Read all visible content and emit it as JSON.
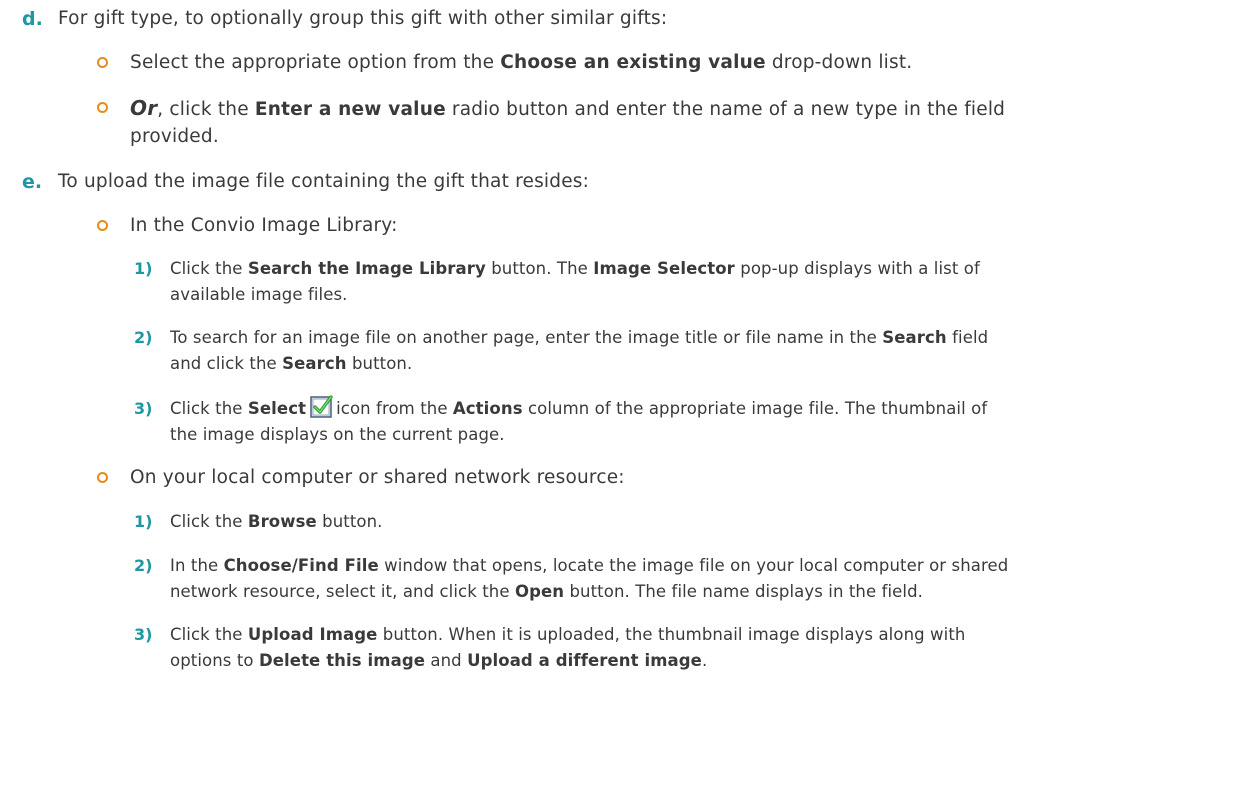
{
  "step_d": {
    "marker": "d.",
    "text": "For gift type, to optionally group this gift with other similar gifts:",
    "bullets": [
      {
        "pre": "Select the appropriate option from the ",
        "bold": "Choose an existing value",
        "post": " drop-down list."
      },
      {
        "or": "Or",
        "pre": ", click the ",
        "bold": "Enter a new value",
        "post_line1": " radio button and enter the name of a new type in the field",
        "post_line2": "provided."
      }
    ]
  },
  "step_e": {
    "marker": "e.",
    "text": "To upload the image file containing the gift that resides:",
    "library": {
      "heading": "In the Convio Image Library:",
      "steps": [
        {
          "num": "1)",
          "l1_pre": "Click the ",
          "l1_b1": "Search the Image Library",
          "l1_mid": " button. The ",
          "l1_b2": "Image Selector",
          "l1_post": " pop-up displays with a list of",
          "l2": "available image files."
        },
        {
          "num": "2)",
          "l1_pre": "To search for an image file on another page, enter the image title or file name in the ",
          "l1_b1": "Search",
          "l1_post": " field",
          "l2_pre": "and click the ",
          "l2_b1": "Search",
          "l2_post": " button."
        },
        {
          "num": "3)",
          "l1_pre": "Click the ",
          "l1_b1": "Select",
          "icon": "select-checkbox-icon",
          "l1_mid": "icon from the ",
          "l1_b2": "Actions",
          "l1_post": " column of the appropriate image file. The thumbnail of",
          "l2": "the image displays on the current page."
        }
      ]
    },
    "local": {
      "heading": "On your local computer or shared network resource:",
      "steps": [
        {
          "num": "1)",
          "l1_pre": "Click the ",
          "l1_b1": "Browse",
          "l1_post": " button."
        },
        {
          "num": "2)",
          "l1_pre": "In the ",
          "l1_b1": "Choose/Find File",
          "l1_post": " window that opens, locate the image file on your local computer or shared",
          "l2_pre": "network resource, select it, and click the ",
          "l2_b1": "Open",
          "l2_post": " button. The file name displays in the field."
        },
        {
          "num": "3)",
          "l1_pre": "Click the ",
          "l1_b1": "Upload Image",
          "l1_post": " button. When it is uploaded, the thumbnail image displays along with",
          "l2_pre": "options to ",
          "l2_b1": "Delete this image",
          "l2_mid": " and ",
          "l2_b2": "Upload a different image",
          "l2_post": "."
        }
      ]
    }
  },
  "colors": {
    "marker": "#1f97a2",
    "bullet": "#e58c1c",
    "text": "#3a3a3a"
  }
}
